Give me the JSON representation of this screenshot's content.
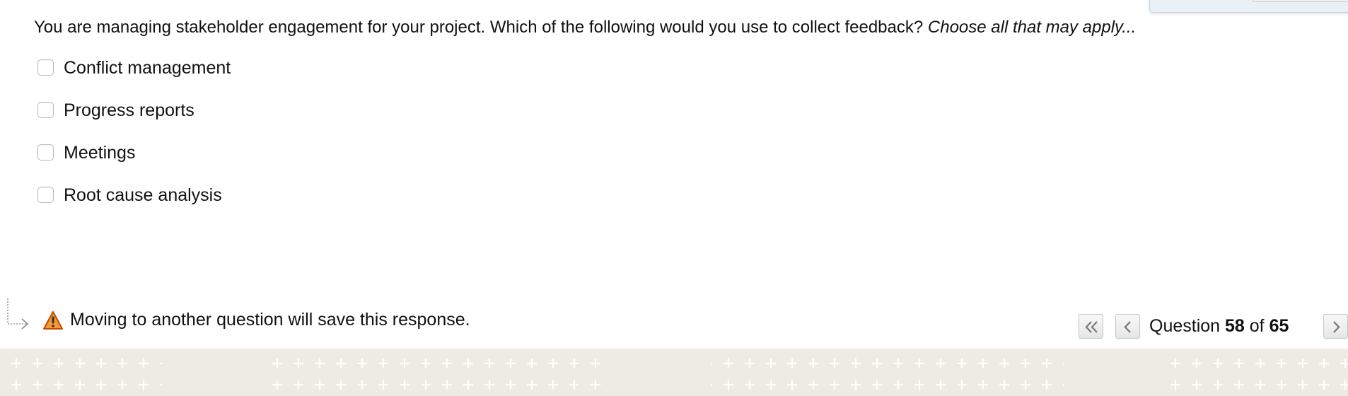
{
  "question": {
    "text": "You are managing stakeholder engagement for your project. Which of the following would you use to collect feedback?",
    "hint": "Choose all that may apply..."
  },
  "options": [
    {
      "label": "Conflict management",
      "checked": false
    },
    {
      "label": "Progress reports",
      "checked": false
    },
    {
      "label": "Meetings",
      "checked": false
    },
    {
      "label": "Root cause analysis",
      "checked": false
    }
  ],
  "footer": {
    "save_note": "Moving to another question will save this response.",
    "warning_icon": "warning-icon",
    "arrow_icon": "redirect-arrow-icon"
  },
  "navigation": {
    "question_word": "Question",
    "current": "58",
    "of_word": "of",
    "total": "65",
    "first_icon": "double-chevron-left-icon",
    "prev_icon": "chevron-left-icon",
    "next_icon": "chevron-right-icon"
  },
  "colors": {
    "pattern_background": "#eeebe4",
    "pattern_cross": "#ffffff",
    "warning_fill": "#f29b35",
    "warning_stroke": "#c84600"
  }
}
